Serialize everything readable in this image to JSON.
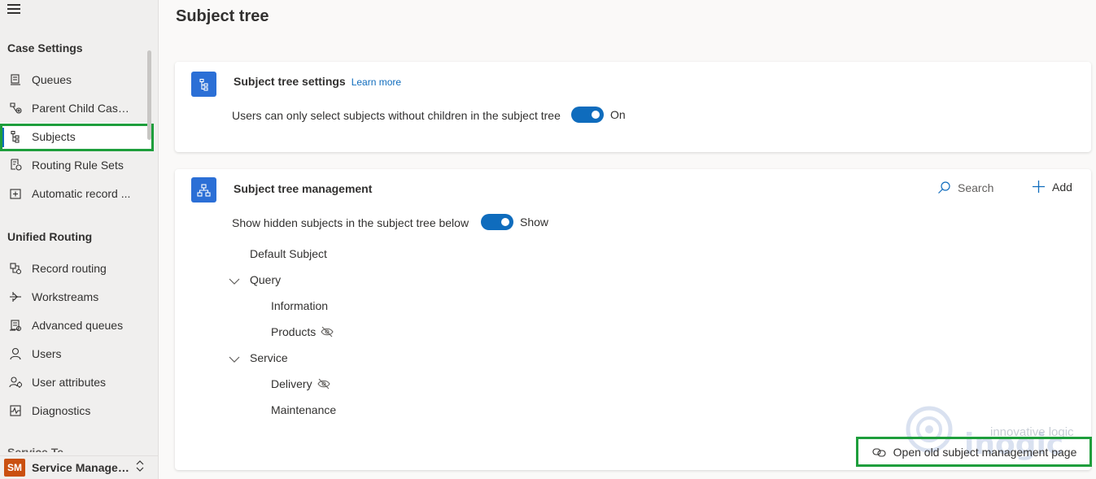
{
  "page": {
    "title": "Subject tree"
  },
  "sidebar": {
    "section1_title": "Case Settings",
    "section1_items": [
      {
        "label": "Queues",
        "icon": "queue-icon"
      },
      {
        "label": "Parent Child Case ...",
        "icon": "parent-child-icon"
      },
      {
        "label": "Subjects",
        "icon": "subject-tree-icon",
        "active": true
      },
      {
        "label": "Routing Rule Sets",
        "icon": "routing-rules-icon"
      },
      {
        "label": "Automatic record ...",
        "icon": "auto-record-icon"
      }
    ],
    "section2_title": "Unified Routing",
    "section2_items": [
      {
        "label": "Record routing",
        "icon": "record-routing-icon"
      },
      {
        "label": "Workstreams",
        "icon": "workstreams-icon"
      },
      {
        "label": "Advanced queues",
        "icon": "advanced-queues-icon"
      },
      {
        "label": "Users",
        "icon": "user-icon"
      },
      {
        "label": "User attributes",
        "icon": "user-attributes-icon"
      },
      {
        "label": "Diagnostics",
        "icon": "diagnostics-icon"
      }
    ],
    "area": {
      "badge": "SM",
      "name": "Service Managem...",
      "badge_color": "#ca5010"
    }
  },
  "settings_card": {
    "title": "Subject tree settings",
    "learn_more": "Learn more",
    "setting_text": "Users can only select subjects without children in the subject tree",
    "toggle_state": "On"
  },
  "management_card": {
    "title": "Subject tree management",
    "search_label": "Search",
    "add_label": "Add",
    "show_hidden_text": "Show hidden subjects in the subject tree below",
    "show_hidden_state": "Show",
    "tree": {
      "default": "Default Subject",
      "query": "Query",
      "information": "Information",
      "products": "Products",
      "service": "Service",
      "delivery": "Delivery",
      "maintenance": "Maintenance"
    },
    "open_old_link": "Open old subject management page"
  },
  "colors": {
    "accent": "#0f6cbd",
    "icon_bg": "#2b6fd6",
    "highlight": "#1e9e3c"
  },
  "watermark": {
    "text": "innovative logic"
  }
}
